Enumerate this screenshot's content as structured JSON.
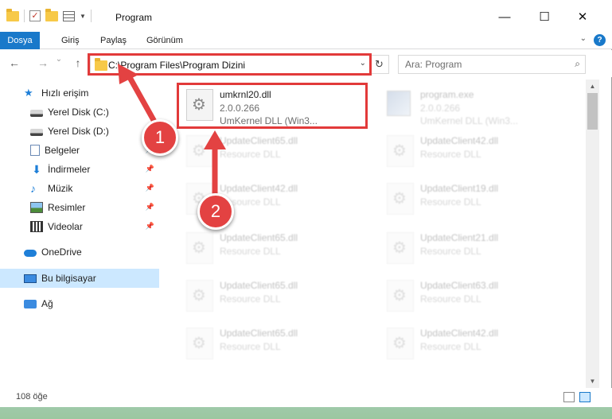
{
  "window": {
    "title": "Program",
    "controls": {
      "minimize": "—",
      "maximize": "☐",
      "close": "✕"
    }
  },
  "ribbon": {
    "tabs": [
      {
        "label": "Dosya"
      },
      {
        "label": "Giriş"
      },
      {
        "label": "Paylaş"
      },
      {
        "label": "Görünüm"
      }
    ],
    "help": "?"
  },
  "nav": {
    "back": "←",
    "forward": "→",
    "recent": "⌄",
    "up": "↑",
    "address": "C:\\Program Files\\Program Dizini",
    "refresh": "↻",
    "search_placeholder": "Ara: Program",
    "search_icon": "⌕"
  },
  "sidebar": {
    "items": [
      {
        "label": "Hızlı erişim",
        "icon": "star-icon",
        "pinned": false
      },
      {
        "label": "Yerel Disk (C:)",
        "icon": "disk-icon",
        "pinned": false
      },
      {
        "label": "Yerel Disk (D:)",
        "icon": "disk-icon",
        "pinned": false
      },
      {
        "label": "Belgeler",
        "icon": "document-icon",
        "pinned": true
      },
      {
        "label": "İndirmeler",
        "icon": "download-icon",
        "pinned": true
      },
      {
        "label": "Müzik",
        "icon": "music-icon",
        "pinned": true
      },
      {
        "label": "Resimler",
        "icon": "picture-icon",
        "pinned": true
      },
      {
        "label": "Videolar",
        "icon": "video-icon",
        "pinned": true
      },
      {
        "label": "OneDrive",
        "icon": "cloud-icon",
        "pinned": false
      },
      {
        "label": "Bu bilgisayar",
        "icon": "computer-icon",
        "pinned": false
      },
      {
        "label": "Ağ",
        "icon": "network-icon",
        "pinned": false
      }
    ]
  },
  "files": [
    {
      "name": "umkrnl20.dll",
      "line2": "2.0.0.266",
      "line3": "UmKernel DLL  (Win3...",
      "highlighted": true
    },
    {
      "name": "program.exe",
      "line2": "2.0.0.266",
      "line3": "UmKernel DLL  (Win3...",
      "faded": true
    },
    {
      "name": "UpdateClient65.dll",
      "line2": "Resource DLL",
      "faded": true
    },
    {
      "name": "UpdateClient42.dll",
      "line2": "Resource DLL",
      "faded": true
    },
    {
      "name": "UpdateClient42.dll",
      "line2": "Resource DLL",
      "faded": true
    },
    {
      "name": "UpdateClient19.dll",
      "line2": "Resource DLL",
      "faded": true
    },
    {
      "name": "UpdateClient65.dll",
      "line2": "Resource DLL",
      "faded": true
    },
    {
      "name": "UpdateClient21.dll",
      "line2": "Resource DLL",
      "faded": true
    },
    {
      "name": "UpdateClient65.dll",
      "line2": "Resource DLL",
      "faded": true
    },
    {
      "name": "UpdateClient63.dll",
      "line2": "Resource DLL",
      "faded": true
    },
    {
      "name": "UpdateClient65.dll",
      "line2": "Resource DLL",
      "faded": true
    },
    {
      "name": "UpdateClient42.dll",
      "line2": "Resource DLL",
      "faded": true
    }
  ],
  "status": {
    "item_count": "108 öğe"
  },
  "annotations": {
    "step1": "1",
    "step2": "2",
    "color": "#e34242"
  }
}
